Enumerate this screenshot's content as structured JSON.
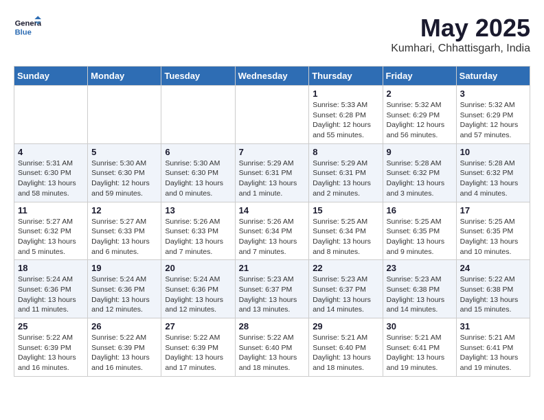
{
  "header": {
    "logo_general": "General",
    "logo_blue": "Blue",
    "month": "May 2025",
    "location": "Kumhari, Chhattisgarh, India"
  },
  "weekdays": [
    "Sunday",
    "Monday",
    "Tuesday",
    "Wednesday",
    "Thursday",
    "Friday",
    "Saturday"
  ],
  "weeks": [
    [
      {
        "day": "",
        "info": ""
      },
      {
        "day": "",
        "info": ""
      },
      {
        "day": "",
        "info": ""
      },
      {
        "day": "",
        "info": ""
      },
      {
        "day": "1",
        "info": "Sunrise: 5:33 AM\nSunset: 6:28 PM\nDaylight: 12 hours and 55 minutes."
      },
      {
        "day": "2",
        "info": "Sunrise: 5:32 AM\nSunset: 6:29 PM\nDaylight: 12 hours and 56 minutes."
      },
      {
        "day": "3",
        "info": "Sunrise: 5:32 AM\nSunset: 6:29 PM\nDaylight: 12 hours and 57 minutes."
      }
    ],
    [
      {
        "day": "4",
        "info": "Sunrise: 5:31 AM\nSunset: 6:30 PM\nDaylight: 13 hours and 58 minutes."
      },
      {
        "day": "5",
        "info": "Sunrise: 5:30 AM\nSunset: 6:30 PM\nDaylight: 12 hours and 59 minutes."
      },
      {
        "day": "6",
        "info": "Sunrise: 5:30 AM\nSunset: 6:30 PM\nDaylight: 13 hours and 0 minutes."
      },
      {
        "day": "7",
        "info": "Sunrise: 5:29 AM\nSunset: 6:31 PM\nDaylight: 13 hours and 1 minute."
      },
      {
        "day": "8",
        "info": "Sunrise: 5:29 AM\nSunset: 6:31 PM\nDaylight: 13 hours and 2 minutes."
      },
      {
        "day": "9",
        "info": "Sunrise: 5:28 AM\nSunset: 6:32 PM\nDaylight: 13 hours and 3 minutes."
      },
      {
        "day": "10",
        "info": "Sunrise: 5:28 AM\nSunset: 6:32 PM\nDaylight: 13 hours and 4 minutes."
      }
    ],
    [
      {
        "day": "11",
        "info": "Sunrise: 5:27 AM\nSunset: 6:32 PM\nDaylight: 13 hours and 5 minutes."
      },
      {
        "day": "12",
        "info": "Sunrise: 5:27 AM\nSunset: 6:33 PM\nDaylight: 13 hours and 6 minutes."
      },
      {
        "day": "13",
        "info": "Sunrise: 5:26 AM\nSunset: 6:33 PM\nDaylight: 13 hours and 7 minutes."
      },
      {
        "day": "14",
        "info": "Sunrise: 5:26 AM\nSunset: 6:34 PM\nDaylight: 13 hours and 7 minutes."
      },
      {
        "day": "15",
        "info": "Sunrise: 5:25 AM\nSunset: 6:34 PM\nDaylight: 13 hours and 8 minutes."
      },
      {
        "day": "16",
        "info": "Sunrise: 5:25 AM\nSunset: 6:35 PM\nDaylight: 13 hours and 9 minutes."
      },
      {
        "day": "17",
        "info": "Sunrise: 5:25 AM\nSunset: 6:35 PM\nDaylight: 13 hours and 10 minutes."
      }
    ],
    [
      {
        "day": "18",
        "info": "Sunrise: 5:24 AM\nSunset: 6:36 PM\nDaylight: 13 hours and 11 minutes."
      },
      {
        "day": "19",
        "info": "Sunrise: 5:24 AM\nSunset: 6:36 PM\nDaylight: 13 hours and 12 minutes."
      },
      {
        "day": "20",
        "info": "Sunrise: 5:24 AM\nSunset: 6:36 PM\nDaylight: 13 hours and 12 minutes."
      },
      {
        "day": "21",
        "info": "Sunrise: 5:23 AM\nSunset: 6:37 PM\nDaylight: 13 hours and 13 minutes."
      },
      {
        "day": "22",
        "info": "Sunrise: 5:23 AM\nSunset: 6:37 PM\nDaylight: 13 hours and 14 minutes."
      },
      {
        "day": "23",
        "info": "Sunrise: 5:23 AM\nSunset: 6:38 PM\nDaylight: 13 hours and 14 minutes."
      },
      {
        "day": "24",
        "info": "Sunrise: 5:22 AM\nSunset: 6:38 PM\nDaylight: 13 hours and 15 minutes."
      }
    ],
    [
      {
        "day": "25",
        "info": "Sunrise: 5:22 AM\nSunset: 6:39 PM\nDaylight: 13 hours and 16 minutes."
      },
      {
        "day": "26",
        "info": "Sunrise: 5:22 AM\nSunset: 6:39 PM\nDaylight: 13 hours and 16 minutes."
      },
      {
        "day": "27",
        "info": "Sunrise: 5:22 AM\nSunset: 6:39 PM\nDaylight: 13 hours and 17 minutes."
      },
      {
        "day": "28",
        "info": "Sunrise: 5:22 AM\nSunset: 6:40 PM\nDaylight: 13 hours and 18 minutes."
      },
      {
        "day": "29",
        "info": "Sunrise: 5:21 AM\nSunset: 6:40 PM\nDaylight: 13 hours and 18 minutes."
      },
      {
        "day": "30",
        "info": "Sunrise: 5:21 AM\nSunset: 6:41 PM\nDaylight: 13 hours and 19 minutes."
      },
      {
        "day": "31",
        "info": "Sunrise: 5:21 AM\nSunset: 6:41 PM\nDaylight: 13 hours and 19 minutes."
      }
    ]
  ]
}
